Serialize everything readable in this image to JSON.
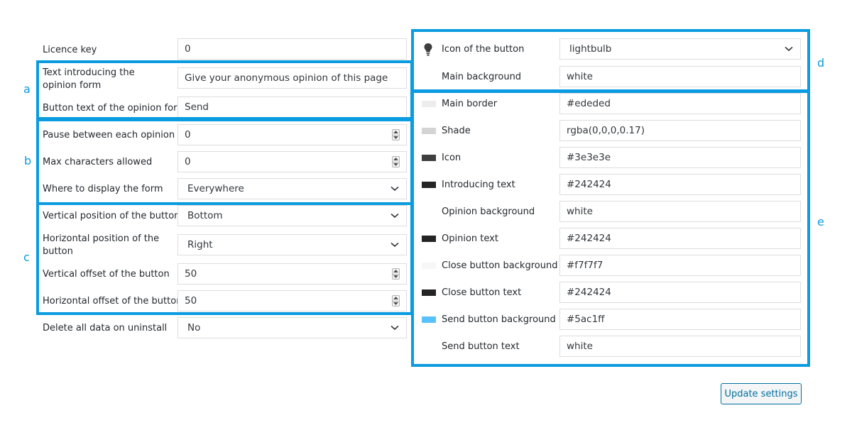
{
  "left": {
    "licence_key": {
      "label": "Licence key",
      "value": "0"
    },
    "intro_text": {
      "label": "Text introducing the opinion form",
      "value": "Give your anonymous opinion of this page"
    },
    "button_text": {
      "label": "Button text of the opinion form",
      "value": "Send"
    },
    "pause": {
      "label": "Pause between each opinion",
      "value": "0"
    },
    "max_chars": {
      "label": "Max characters allowed",
      "value": "0"
    },
    "display_where": {
      "label": "Where to display the form",
      "value": "Everywhere"
    },
    "vertical_position": {
      "label": "Vertical position of the button",
      "value": "Bottom"
    },
    "horizontal_position": {
      "label": "Horizontal position of the button",
      "value": "Right"
    },
    "vertical_offset": {
      "label": "Vertical offset of the button",
      "value": "50"
    },
    "horizontal_offset": {
      "label": "Horizontal offset of the button",
      "value": "50"
    },
    "delete_data": {
      "label": "Delete all data on uninstall",
      "value": "No"
    }
  },
  "right": {
    "icon": {
      "label": "Icon of the button",
      "value": "lightbulb",
      "icon_name": "lightbulb-icon"
    },
    "main_background": {
      "label": "Main background",
      "value": "white"
    },
    "colors": [
      {
        "label": "Main border",
        "value": "#ededed",
        "swatch": "#ededed"
      },
      {
        "label": "Shade",
        "value": "rgba(0,0,0,0.17)",
        "swatch": "#d4d4d4"
      },
      {
        "label": "Icon",
        "value": "#3e3e3e",
        "swatch": "#3e3e3e"
      },
      {
        "label": "Introducing text",
        "value": "#242424",
        "swatch": "#242424"
      },
      {
        "label": "Opinion background",
        "value": "white",
        "swatch": "#ffffff"
      },
      {
        "label": "Opinion text",
        "value": "#242424",
        "swatch": "#242424"
      },
      {
        "label": "Close button background",
        "value": "#f7f7f7",
        "swatch": "#f7f7f7"
      },
      {
        "label": "Close button text",
        "value": "#242424",
        "swatch": "#242424"
      },
      {
        "label": "Send button background",
        "value": "#5ac1ff",
        "swatch": "#5ac1ff"
      },
      {
        "label": "Send button text",
        "value": "white",
        "swatch": "#ffffff"
      }
    ]
  },
  "annotations": {
    "a": "a",
    "b": "b",
    "c": "c",
    "d": "d",
    "e": "e"
  },
  "update_label": "Update settings",
  "accent_color": "#0a9be0"
}
